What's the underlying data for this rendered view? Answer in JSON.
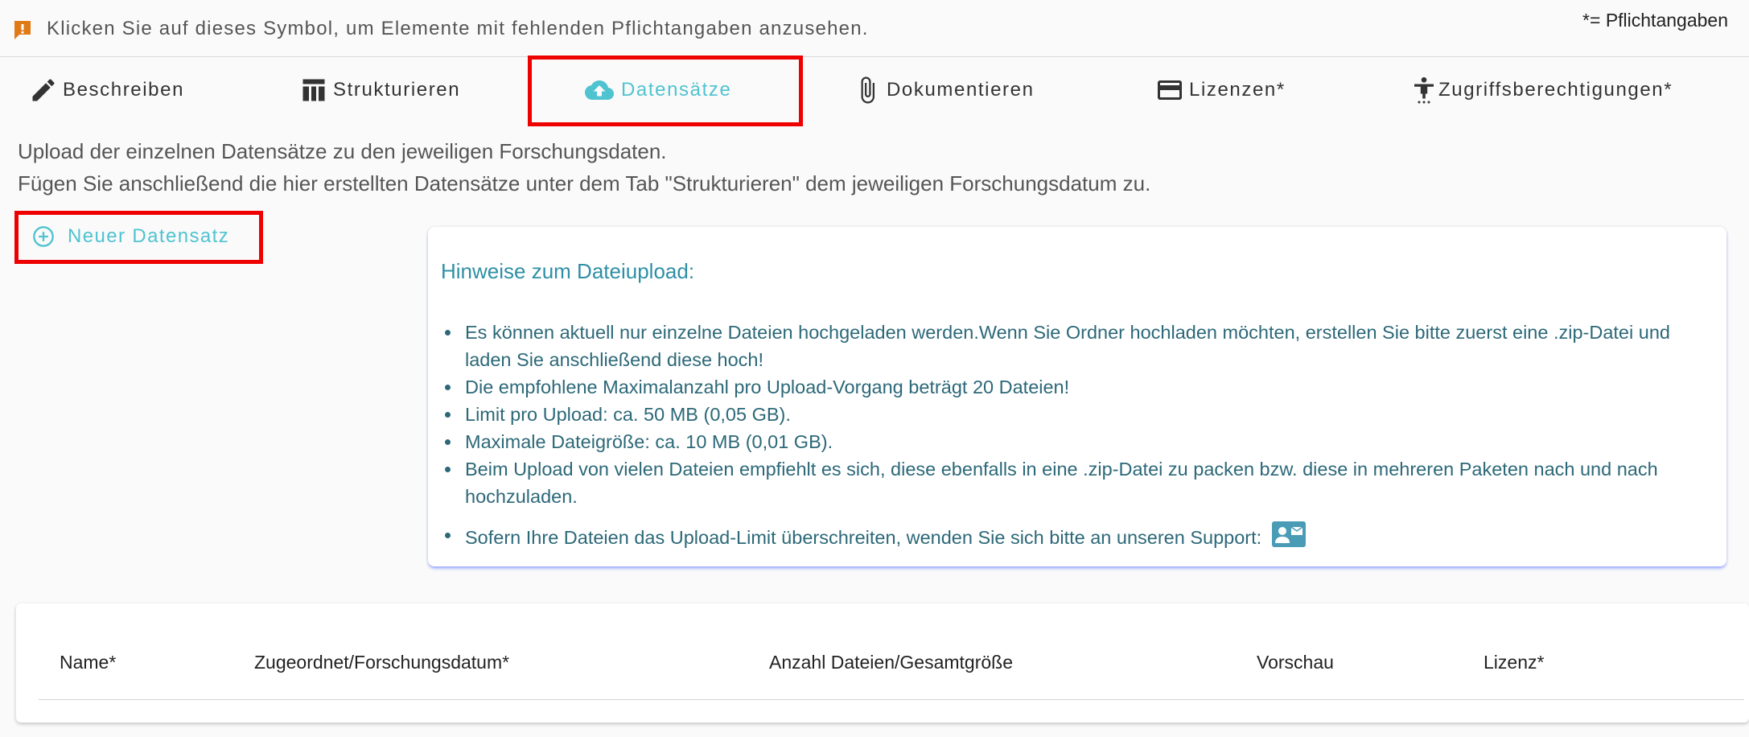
{
  "banner": {
    "warning_text": "Klicken Sie auf dieses Symbol, um Elemente mit fehlenden Pflichtangaben anzusehen.",
    "required_note": "*= Pflichtangaben",
    "warning_color": "#e07a16"
  },
  "tabs": [
    {
      "label": "Beschreiben",
      "icon": "pencil-icon"
    },
    {
      "label": "Strukturieren",
      "icon": "table-icon"
    },
    {
      "label": "Datensätze",
      "icon": "cloud-upload-icon",
      "active": true
    },
    {
      "label": "Dokumentieren",
      "icon": "paperclip-icon"
    },
    {
      "label": "Lizenzen*",
      "icon": "credit-card-icon"
    },
    {
      "label": "Zugriffsberechtigungen*",
      "icon": "accessibility-icon"
    }
  ],
  "intro": {
    "line1": "Upload der einzelnen Datensätze zu den jeweiligen Forschungsdaten.",
    "line2": "Fügen Sie anschließend die hier erstellten Datensätze unter dem Tab \"Strukturieren\" dem jeweiligen Forschungsdatum zu."
  },
  "new_dataset_label": "Neuer Datensatz",
  "hints": {
    "title": "Hinweise zum Dateiupload:",
    "items": [
      "Es können aktuell nur einzelne Dateien hochgeladen werden.Wenn Sie Ordner hochladen möchten, erstellen Sie bitte zuerst eine .zip-Datei und laden Sie anschließend diese hoch!",
      "Die empfohlene Maximalanzahl pro Upload-Vorgang beträgt 20 Dateien!",
      "Limit pro Upload: ca. 50 MB (0,05 GB).",
      "Maximale Dateigröße: ca. 10 MB (0,01 GB).",
      "Beim Upload von vielen Dateien empfiehlt es sich, diese ebenfalls in eine .zip-Datei zu packen bzw. diese in mehreren Paketen nach und nach hochzuladen.",
      "Sofern Ihre Dateien das Upload-Limit überschreiten, wenden Sie sich bitte an unseren Support:"
    ]
  },
  "table": {
    "columns": [
      "Name*",
      "Zugeordnet/Forschungsdatum*",
      "Anzahl Dateien/Gesamtgröße",
      "Vorschau",
      "Lizenz*"
    ]
  },
  "colors": {
    "accent": "#4fc3d0",
    "hint_text": "#2c6878",
    "highlight_box": "#ee0000"
  }
}
